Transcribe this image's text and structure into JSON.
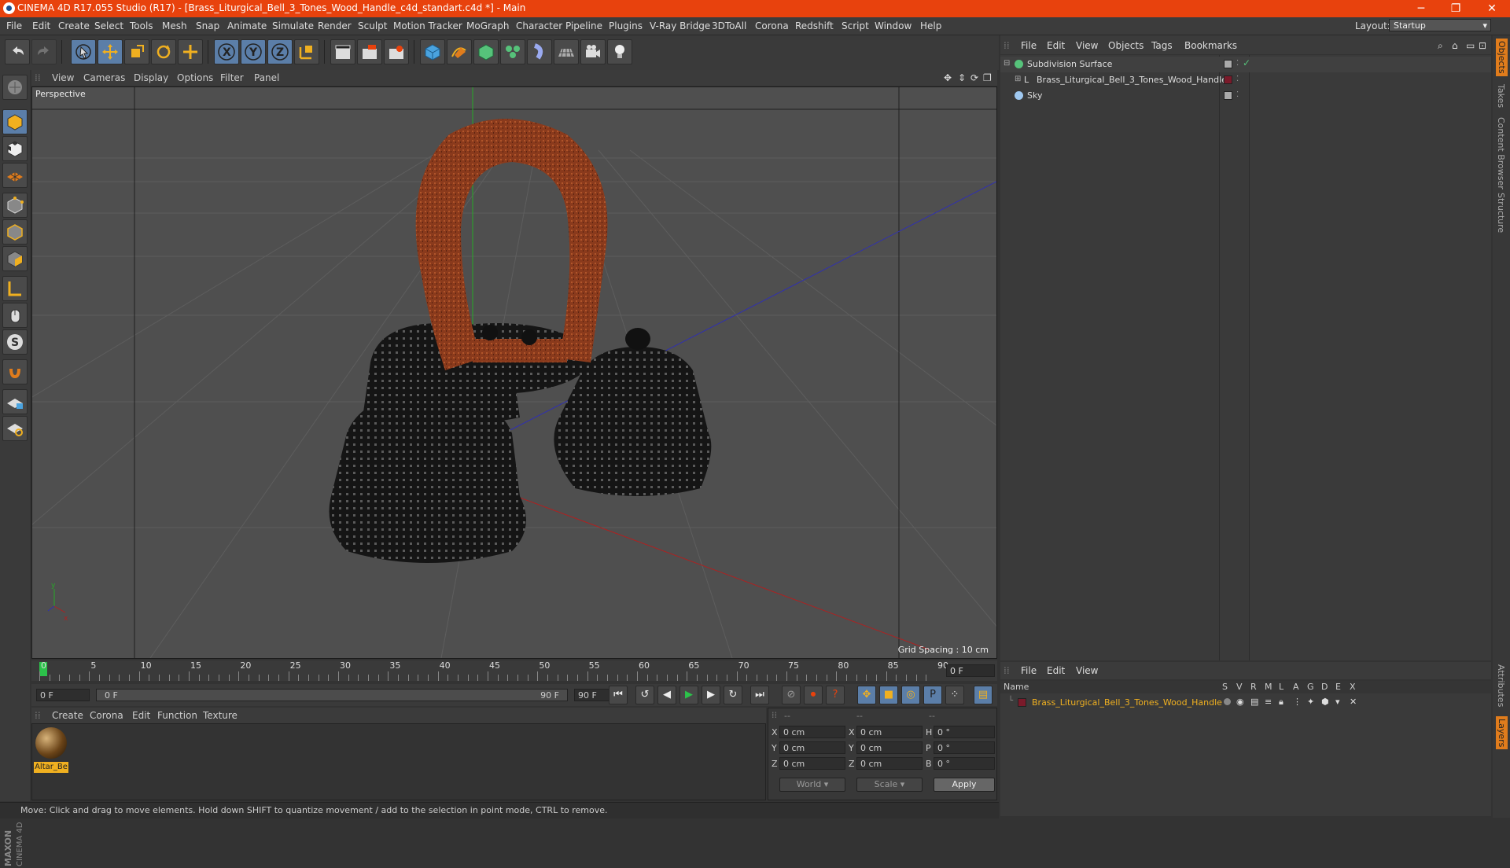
{
  "window": {
    "title": "CINEMA 4D R17.055 Studio (R17) - [Brass_Liturgical_Bell_3_Tones_Wood_Handle_c4d_standart.c4d *] - Main",
    "minimize": "─",
    "restore": "❐",
    "close": "✕"
  },
  "menubar": {
    "items": [
      "File",
      "Edit",
      "Create",
      "Select",
      "Tools",
      "Mesh",
      "Snap",
      "Animate",
      "Simulate",
      "Render",
      "Sculpt",
      "Motion Tracker",
      "MoGraph",
      "Character",
      "Pipeline",
      "Plugins",
      "V-Ray Bridge",
      "3DToAll",
      "Corona",
      "Redshift",
      "Script",
      "Window",
      "Help"
    ],
    "layout_label": "Layout:",
    "layout_value": "Startup"
  },
  "viewport": {
    "menu": [
      "View",
      "Cameras",
      "Display",
      "Options",
      "Filter",
      "Panel"
    ],
    "label": "Perspective",
    "grid_spacing": "Grid Spacing : 10 cm"
  },
  "timeline": {
    "ticks": [
      "0",
      "5",
      "10",
      "15",
      "20",
      "25",
      "30",
      "35",
      "40",
      "45",
      "50",
      "55",
      "60",
      "65",
      "70",
      "75",
      "80",
      "85",
      "90"
    ],
    "current_frame": "0 F",
    "start_field": "0 F",
    "range_start": "0 F",
    "range_end": "90 F",
    "end_field": "90 F"
  },
  "material_manager": {
    "menu": [
      "Create",
      "Corona",
      "Edit",
      "Function",
      "Texture"
    ],
    "materials": [
      {
        "label": "Altar_Be"
      }
    ]
  },
  "coordinates": {
    "header": [
      "--",
      "--",
      "--"
    ],
    "rows": [
      {
        "axis1": "X",
        "val1": "0 cm",
        "axis2": "X",
        "val2": "0 cm",
        "axis3": "H",
        "val3": "0 °"
      },
      {
        "axis1": "Y",
        "val1": "0 cm",
        "axis2": "Y",
        "val2": "0 cm",
        "axis3": "P",
        "val3": "0 °"
      },
      {
        "axis1": "Z",
        "val1": "0 cm",
        "axis2": "Z",
        "val2": "0 cm",
        "axis3": "B",
        "val3": "0 °"
      }
    ],
    "space": "World",
    "mode": "Scale",
    "apply": "Apply"
  },
  "object_manager": {
    "menu": [
      "File",
      "Edit",
      "View",
      "Objects",
      "Tags",
      "Bookmarks"
    ],
    "objects": [
      {
        "name": "Subdivision Surface"
      },
      {
        "name": "Brass_Liturgical_Bell_3_Tones_Wood_Handle"
      },
      {
        "name": "Sky"
      }
    ]
  },
  "layer_manager": {
    "menu": [
      "File",
      "Edit",
      "View"
    ],
    "columns": [
      "Name",
      "S",
      "V",
      "R",
      "M",
      "L",
      "A",
      "G",
      "D",
      "E",
      "X"
    ],
    "layers": [
      {
        "name": "Brass_Liturgical_Bell_3_Tones_Wood_Handle"
      }
    ]
  },
  "side_tabs": [
    "Objects",
    "Takes",
    "Content Browser",
    "Structure",
    "Attributes",
    "Layers"
  ],
  "status": "Move: Click and drag to move elements. Hold down SHIFT to quantize movement / add to the selection in point mode, CTRL to remove.",
  "brand": "MAXON CINEMA 4D",
  "colors": {
    "accent": "#e8420d",
    "selection": "#5b7ea8",
    "highlight": "#f0b020"
  }
}
